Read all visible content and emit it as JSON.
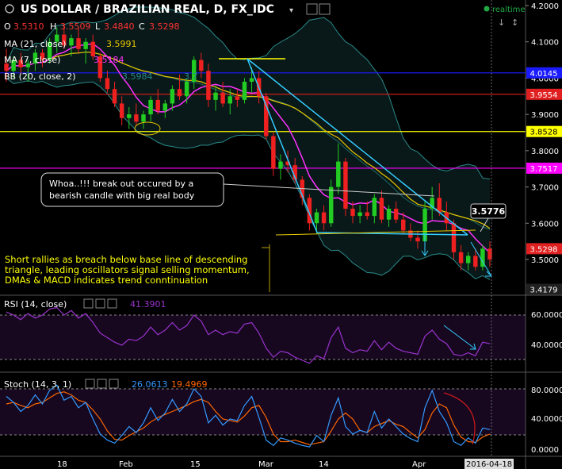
{
  "header": {
    "title": "US DOLLAR / BRAZILIAN REAL, D, FX_IDC",
    "status": "realtime",
    "ohlc": [
      {
        "label": "O",
        "value": "3.5310"
      },
      {
        "label": "H",
        "value": "3.5509"
      },
      {
        "label": "L",
        "value": "3.4840"
      },
      {
        "label": "C",
        "value": "3.5298"
      }
    ]
  },
  "indicators": {
    "ma21": {
      "label": "MA (21, close)",
      "value": "3.5991"
    },
    "ma7": {
      "label": "MA (7, close)",
      "value": "3.5184"
    },
    "bb": {
      "label": "BB (20, close, 2)",
      "value": "3.5984",
      "value2": "3.7"
    },
    "rsi": {
      "label": "RSI (14, close)",
      "value": "41.3901"
    },
    "stoch": {
      "label": "Stoch (14, 3, 1)",
      "value": "26.0613",
      "value2": "19.4969"
    }
  },
  "annotations": {
    "breakout_note": "Whoa..!!! break out occured by a bearish candle with big real body",
    "breakout_line1": "Whoa..!!! break out occured by a",
    "breakout_line2": "bearish candle with big real body",
    "rally_note_line1": "Short rallies as breach below base line of descending",
    "rally_note_line2": "triangle, leading oscillators signal selling momentum,",
    "rally_note_line3": "DMAs & MACD indicates trend conntinuation",
    "callout_value": "3.5776"
  },
  "price_axis": {
    "ticks": [
      "4.2000",
      "4.1000",
      "4.0000",
      "3.9000",
      "3.8000",
      "3.7000",
      "3.6000",
      "3.5000"
    ],
    "tick_values": [
      4.2,
      4.1,
      4.0,
      3.9,
      3.8,
      3.7,
      3.6,
      3.5
    ],
    "badges": [
      {
        "value": "4.0145",
        "color": "#1a1aff",
        "text_color": "#ffffff"
      },
      {
        "value": "3.9554",
        "color": "#e02020",
        "text_color": "#ffffff"
      },
      {
        "value": "3.8528",
        "color": "#ffff00",
        "text_color": "#000000"
      },
      {
        "value": "3.7517",
        "color": "#ff00ff",
        "text_color": "#ffffff"
      },
      {
        "value": "3.5298",
        "color": "#e02020",
        "text_color": "#ffffff"
      },
      {
        "value": "3.4179",
        "color": "#202020",
        "text_color": "#ffffff"
      }
    ]
  },
  "rsi_axis": {
    "ticks": [
      "60.0000",
      "40.0000"
    ]
  },
  "stoch_axis": {
    "ticks": [
      "80.0000",
      "40.0000",
      "0.0000"
    ]
  },
  "time_axis": {
    "labels": [
      "18",
      "Feb",
      "15",
      "Mar",
      "14",
      "Apr",
      "2016-04-18"
    ]
  },
  "colors": {
    "up": "#22cc22",
    "down": "#ee2020",
    "ma21": "#e8c800",
    "ma7": "#ff33ff",
    "bb": "#2a8a8a",
    "triangle": "#33ccff",
    "horizontal_blue": "#1a1aff",
    "horizontal_red": "#e02020",
    "horizontal_yellow": "#ffff00",
    "horizontal_magenta": "#ff00ff",
    "rsi": "#9933cc",
    "stoch_k": "#3399ff",
    "stoch_d": "#ff6600"
  },
  "chart_data": {
    "type": "candlestick",
    "title": "US DOLLAR / BRAZILIAN REAL, D, FX_IDC",
    "ylim": [
      3.42,
      4.2
    ],
    "candles": [
      {
        "o": 4.04,
        "h": 4.08,
        "l": 3.99,
        "c": 4.02
      },
      {
        "o": 4.02,
        "h": 4.06,
        "l": 4.0,
        "c": 4.05
      },
      {
        "o": 4.05,
        "h": 4.07,
        "l": 4.01,
        "c": 4.03
      },
      {
        "o": 4.03,
        "h": 4.05,
        "l": 3.99,
        "c": 4.04
      },
      {
        "o": 4.04,
        "h": 4.08,
        "l": 4.02,
        "c": 4.07
      },
      {
        "o": 4.07,
        "h": 4.08,
        "l": 4.03,
        "c": 4.05
      },
      {
        "o": 4.05,
        "h": 4.11,
        "l": 4.04,
        "c": 4.1
      },
      {
        "o": 4.1,
        "h": 4.14,
        "l": 4.07,
        "c": 4.12
      },
      {
        "o": 4.12,
        "h": 4.15,
        "l": 4.08,
        "c": 4.09
      },
      {
        "o": 4.09,
        "h": 4.12,
        "l": 4.06,
        "c": 4.11
      },
      {
        "o": 4.11,
        "h": 4.14,
        "l": 4.07,
        "c": 4.08
      },
      {
        "o": 4.08,
        "h": 4.11,
        "l": 4.04,
        "c": 4.1
      },
      {
        "o": 4.1,
        "h": 4.12,
        "l": 4.05,
        "c": 4.06
      },
      {
        "o": 4.06,
        "h": 4.07,
        "l": 3.99,
        "c": 4.0
      },
      {
        "o": 4.0,
        "h": 4.02,
        "l": 3.96,
        "c": 3.97
      },
      {
        "o": 3.97,
        "h": 3.99,
        "l": 3.92,
        "c": 3.93
      },
      {
        "o": 3.93,
        "h": 3.95,
        "l": 3.87,
        "c": 3.89
      },
      {
        "o": 3.89,
        "h": 3.92,
        "l": 3.86,
        "c": 3.9
      },
      {
        "o": 3.9,
        "h": 3.93,
        "l": 3.87,
        "c": 3.88
      },
      {
        "o": 3.88,
        "h": 3.91,
        "l": 3.86,
        "c": 3.9
      },
      {
        "o": 3.9,
        "h": 3.95,
        "l": 3.88,
        "c": 3.94
      },
      {
        "o": 3.94,
        "h": 3.97,
        "l": 3.9,
        "c": 3.91
      },
      {
        "o": 3.91,
        "h": 3.94,
        "l": 3.89,
        "c": 3.93
      },
      {
        "o": 3.93,
        "h": 3.98,
        "l": 3.91,
        "c": 3.97
      },
      {
        "o": 3.97,
        "h": 4.01,
        "l": 3.94,
        "c": 3.95
      },
      {
        "o": 3.95,
        "h": 4.0,
        "l": 3.93,
        "c": 3.99
      },
      {
        "o": 3.99,
        "h": 4.06,
        "l": 3.97,
        "c": 4.05
      },
      {
        "o": 4.05,
        "h": 4.07,
        "l": 4.0,
        "c": 4.02
      },
      {
        "o": 4.02,
        "h": 4.04,
        "l": 3.92,
        "c": 3.94
      },
      {
        "o": 3.94,
        "h": 3.98,
        "l": 3.91,
        "c": 3.96
      },
      {
        "o": 3.96,
        "h": 3.99,
        "l": 3.92,
        "c": 3.93
      },
      {
        "o": 3.93,
        "h": 3.97,
        "l": 3.9,
        "c": 3.95
      },
      {
        "o": 3.95,
        "h": 3.97,
        "l": 3.92,
        "c": 3.94
      },
      {
        "o": 3.94,
        "h": 4.0,
        "l": 3.93,
        "c": 3.99
      },
      {
        "o": 3.99,
        "h": 4.03,
        "l": 3.96,
        "c": 4.0
      },
      {
        "o": 4.0,
        "h": 4.02,
        "l": 3.93,
        "c": 3.95
      },
      {
        "o": 3.95,
        "h": 3.96,
        "l": 3.83,
        "c": 3.84
      },
      {
        "o": 3.84,
        "h": 3.85,
        "l": 3.73,
        "c": 3.75
      },
      {
        "o": 3.75,
        "h": 3.79,
        "l": 3.72,
        "c": 3.77
      },
      {
        "o": 3.77,
        "h": 3.8,
        "l": 3.74,
        "c": 3.76
      },
      {
        "o": 3.76,
        "h": 3.78,
        "l": 3.71,
        "c": 3.72
      },
      {
        "o": 3.72,
        "h": 3.73,
        "l": 3.65,
        "c": 3.67
      },
      {
        "o": 3.67,
        "h": 3.68,
        "l": 3.58,
        "c": 3.6
      },
      {
        "o": 3.6,
        "h": 3.64,
        "l": 3.57,
        "c": 3.63
      },
      {
        "o": 3.63,
        "h": 3.65,
        "l": 3.58,
        "c": 3.6
      },
      {
        "o": 3.6,
        "h": 3.72,
        "l": 3.59,
        "c": 3.7
      },
      {
        "o": 3.7,
        "h": 3.82,
        "l": 3.68,
        "c": 3.77
      },
      {
        "o": 3.77,
        "h": 3.78,
        "l": 3.62,
        "c": 3.64
      },
      {
        "o": 3.64,
        "h": 3.66,
        "l": 3.6,
        "c": 3.62
      },
      {
        "o": 3.62,
        "h": 3.65,
        "l": 3.6,
        "c": 3.63
      },
      {
        "o": 3.63,
        "h": 3.66,
        "l": 3.61,
        "c": 3.62
      },
      {
        "o": 3.62,
        "h": 3.68,
        "l": 3.6,
        "c": 3.67
      },
      {
        "o": 3.67,
        "h": 3.69,
        "l": 3.6,
        "c": 3.61
      },
      {
        "o": 3.61,
        "h": 3.65,
        "l": 3.59,
        "c": 3.64
      },
      {
        "o": 3.64,
        "h": 3.66,
        "l": 3.6,
        "c": 3.61
      },
      {
        "o": 3.61,
        "h": 3.63,
        "l": 3.57,
        "c": 3.58
      },
      {
        "o": 3.58,
        "h": 3.6,
        "l": 3.55,
        "c": 3.56
      },
      {
        "o": 3.56,
        "h": 3.58,
        "l": 3.53,
        "c": 3.55
      },
      {
        "o": 3.55,
        "h": 3.66,
        "l": 3.54,
        "c": 3.64
      },
      {
        "o": 3.64,
        "h": 3.7,
        "l": 3.61,
        "c": 3.67
      },
      {
        "o": 3.67,
        "h": 3.71,
        "l": 3.62,
        "c": 3.63
      },
      {
        "o": 3.63,
        "h": 3.66,
        "l": 3.58,
        "c": 3.6
      },
      {
        "o": 3.6,
        "h": 3.61,
        "l": 3.5,
        "c": 3.52
      },
      {
        "o": 3.52,
        "h": 3.54,
        "l": 3.47,
        "c": 3.49
      },
      {
        "o": 3.49,
        "h": 3.52,
        "l": 3.47,
        "c": 3.51
      },
      {
        "o": 3.51,
        "h": 3.53,
        "l": 3.47,
        "c": 3.48
      },
      {
        "o": 3.48,
        "h": 3.54,
        "l": 3.47,
        "c": 3.53
      },
      {
        "o": 3.53,
        "h": 3.55,
        "l": 3.48,
        "c": 3.5
      }
    ],
    "horizontal_levels": [
      4.0145,
      3.9554,
      3.8528,
      3.7517
    ],
    "rsi": [
      62,
      60,
      57,
      61,
      58,
      60,
      64,
      65,
      60,
      63,
      58,
      61,
      55,
      48,
      45,
      42,
      40,
      44,
      43,
      46,
      52,
      47,
      50,
      55,
      50,
      53,
      60,
      56,
      47,
      50,
      47,
      49,
      48,
      54,
      55,
      48,
      38,
      32,
      36,
      35,
      32,
      30,
      28,
      33,
      31,
      45,
      52,
      38,
      35,
      37,
      36,
      43,
      37,
      42,
      38,
      36,
      35,
      34,
      46,
      50,
      44,
      41,
      34,
      33,
      35,
      33,
      42,
      41
    ],
    "stoch_k": [
      70,
      62,
      50,
      58,
      72,
      60,
      78,
      85,
      65,
      70,
      55,
      62,
      40,
      20,
      12,
      8,
      18,
      30,
      22,
      35,
      55,
      38,
      48,
      66,
      50,
      60,
      80,
      70,
      35,
      45,
      32,
      40,
      38,
      58,
      70,
      42,
      12,
      5,
      15,
      12,
      8,
      5,
      3,
      18,
      10,
      45,
      68,
      30,
      20,
      25,
      22,
      50,
      28,
      40,
      30,
      20,
      14,
      10,
      55,
      78,
      50,
      35,
      10,
      5,
      15,
      8,
      28,
      26
    ],
    "stoch_d": [
      60,
      62,
      58,
      55,
      60,
      62,
      68,
      74,
      76,
      72,
      65,
      62,
      52,
      40,
      24,
      13,
      12,
      18,
      23,
      28,
      36,
      42,
      46,
      50,
      54,
      58,
      63,
      66,
      62,
      50,
      40,
      38,
      36,
      44,
      55,
      58,
      42,
      20,
      10,
      10,
      12,
      9,
      6,
      8,
      10,
      24,
      40,
      48,
      40,
      25,
      22,
      30,
      34,
      38,
      33,
      30,
      22,
      15,
      26,
      48,
      60,
      55,
      32,
      16,
      10,
      9,
      16,
      20
    ]
  }
}
